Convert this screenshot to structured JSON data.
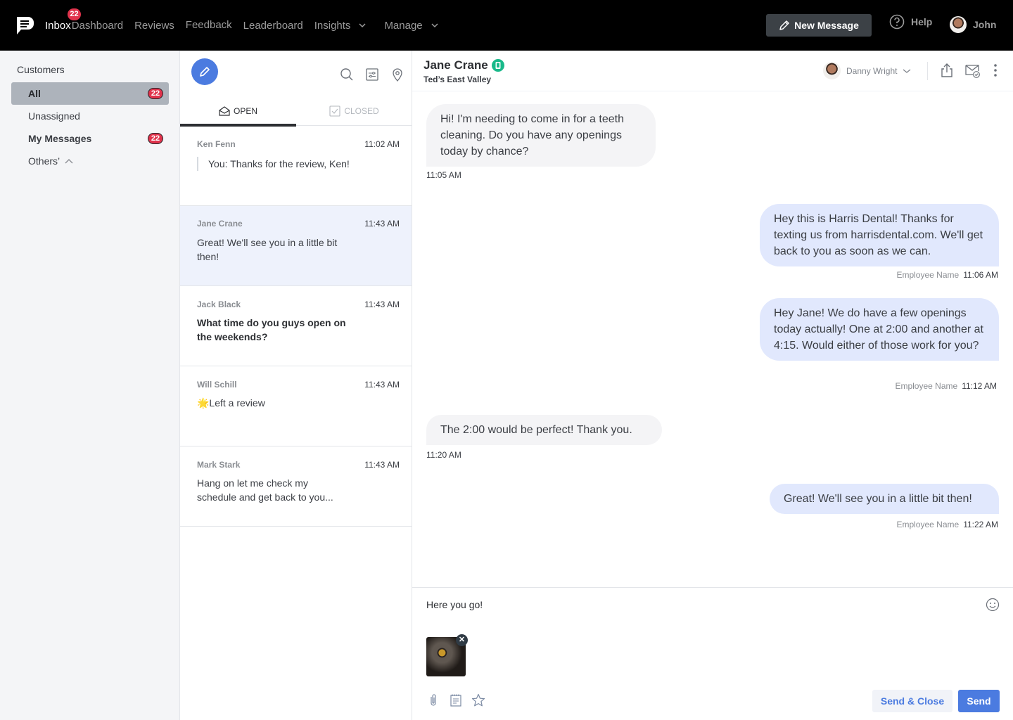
{
  "nav": {
    "items": [
      {
        "label": "Inbox",
        "badge": "22",
        "active": true
      },
      {
        "label": "Dashboard"
      },
      {
        "label": "Reviews"
      },
      {
        "label": "Feedback"
      },
      {
        "label": "Leaderboard"
      },
      {
        "label": "Insights",
        "dropdown": true
      },
      {
        "label": "Manage",
        "dropdown": true
      }
    ],
    "new_message_label": "New Message",
    "help_label": "Help",
    "user_name": "John"
  },
  "sidebar": {
    "heading": "Customers",
    "items": [
      {
        "label": "All",
        "badge": "22",
        "active": true
      },
      {
        "label": "Unassigned"
      },
      {
        "label": "My Messages",
        "badge": "22"
      },
      {
        "label": "Others’"
      }
    ]
  },
  "list": {
    "tabs": [
      {
        "label": "OPEN",
        "active": true
      },
      {
        "label": "CLOSED"
      }
    ],
    "conversations": [
      {
        "name": "Ken Fenn",
        "time": "11:02 AM",
        "preview": "You: Thanks for the review, Ken!"
      },
      {
        "name": "Jane Crane",
        "time": "11:43 AM",
        "preview": "Great! We'll see you in a little bit then!"
      },
      {
        "name": "Jack Black",
        "time": "11:43 AM",
        "preview": "What time do you guys open on the weekends?"
      },
      {
        "name": "Will Schill",
        "time": "11:43 AM",
        "preview": "🌟Left a review"
      },
      {
        "name": "Mark Stark",
        "time": "11:43 AM",
        "preview": "Hang on let me check my schedule and get back to you..."
      }
    ]
  },
  "chat": {
    "contact_name": "Jane Crane",
    "contact_location": "Ted’s East Valley",
    "assignee": "Danny Wright",
    "messages": [
      {
        "direction": "in",
        "text": "Hi! I'm needing to come in for a teeth cleaning. Do you have any openings today by chance?",
        "time": "11:05 AM"
      },
      {
        "direction": "out",
        "text": "Hey this is Harris Dental! Thanks for texting us from harrisdental.com. We'll get back to you as soon as we can.",
        "sender": "Employee Name",
        "time": "11:06 AM"
      },
      {
        "direction": "out",
        "text": "Hey Jane! We do have a few openings today actually! One at 2:00 and another at 4:15. Would either of those work for you?",
        "sender": "Employee Name",
        "time": "11:12 AM"
      },
      {
        "direction": "in",
        "text": "The 2:00 would be perfect! Thank you.",
        "time": "11:20 AM"
      },
      {
        "direction": "out",
        "text": "Great! We'll see you in a little bit then!",
        "sender": "Employee Name",
        "time": "11:22 AM"
      }
    ],
    "composer": {
      "text": "Here you go!",
      "send_close_label": "Send & Close",
      "send_label": "Send"
    }
  },
  "colors": {
    "accent": "#4b7be0",
    "badge": "#e0334c",
    "outgoing_bubble": "#e1e8fd",
    "incoming_bubble": "#f4f4f6",
    "device_badge": "#19b98a"
  }
}
